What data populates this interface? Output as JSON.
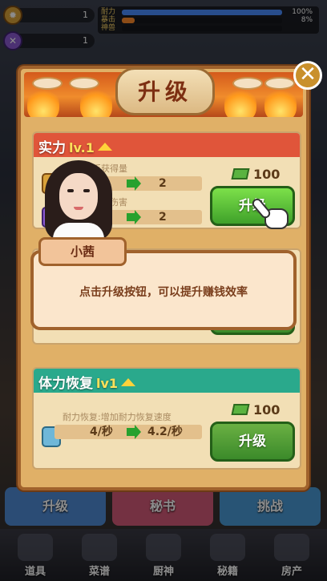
{
  "hud": {
    "stat1_value": "1",
    "stat2_value": "1",
    "bars": [
      {
        "label": "耐力",
        "value": "100%",
        "fill": 1.0,
        "color": "#4a8cff"
      },
      {
        "label": "暴击",
        "value": "8%",
        "fill": 0.08,
        "color": "#ff8a2a"
      },
      {
        "label": "神兽",
        "value": "",
        "fill": 0.0,
        "color": "#9a9a9a"
      }
    ]
  },
  "panel": {
    "title": "升级",
    "close_icon": "✕"
  },
  "card1": {
    "title": "实力",
    "level": "lv.1",
    "row1": {
      "desc": "增加钱币获得量",
      "from": "",
      "to": "2"
    },
    "row2": {
      "desc": "增加战斗中伤害",
      "from": "",
      "to": "2"
    },
    "cost": "100",
    "button": "升级"
  },
  "card2": {
    "title": "体力恢复",
    "level": "lv1",
    "row": {
      "desc": "耐力恢复:增加耐力恢复速度",
      "from": "4/秒",
      "to": "4.2/秒"
    },
    "cost": "100",
    "button": "升级"
  },
  "dialog": {
    "speaker": "小茜",
    "text": "点击升级按钮，可以提升赚钱效率"
  },
  "mid_buttons": [
    "升级",
    "秘书",
    "挑战"
  ],
  "dock": [
    "道具",
    "菜谱",
    "厨神",
    "秘籍",
    "房产"
  ],
  "colors": {
    "card1_header": "#e0553a",
    "card2_header": "#2aa98c",
    "button_green": "#4cb832",
    "panel_border": "#a0622c"
  },
  "icons": [
    "gear-icon",
    "sword-icon",
    "close-icon",
    "up-arrow-icon",
    "cash-icon",
    "hand-pointer-icon",
    "green-arrow-icon",
    "stamina-can-icon"
  ]
}
